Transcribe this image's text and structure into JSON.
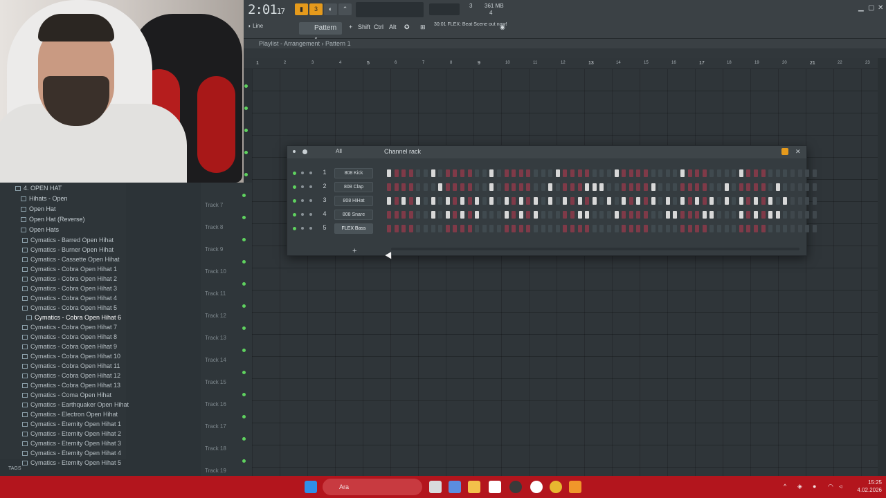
{
  "toolbar": {
    "time": "2:01",
    "time_sub": "17",
    "cpu_label": "361 MB",
    "cpu_sub": "4",
    "poly": "3",
    "snap": "Line",
    "pattern": "Pattern 1",
    "shift": "Shift",
    "ctrl": "Ctrl",
    "alt": "Alt",
    "hint_time": "30:01",
    "hint_text": "FLEX: Beat Scene out now!"
  },
  "playlist": {
    "title": "Playlist - Arrangement",
    "pattern": "Pattern 1",
    "ruler": [
      "1",
      "2",
      "3",
      "4",
      "5",
      "6",
      "7",
      "8",
      "9",
      "10",
      "11",
      "12",
      "13",
      "14",
      "15",
      "16",
      "17",
      "18",
      "19",
      "20",
      "21",
      "22",
      "23"
    ]
  },
  "browser": {
    "folder": "4. OPEN HAT",
    "subfolders": [
      "Hihats - Open",
      "Open Hat",
      "Open Hat (Reverse)",
      "Open Hats"
    ],
    "files": [
      "Cymatics - Barred Open Hihat",
      "Cymatics - Burner Open Hihat",
      "Cymatics - Cassette Open Hihat",
      "Cymatics - Cobra Open Hihat 1",
      "Cymatics - Cobra Open Hihat 2",
      "Cymatics - Cobra Open Hihat 3",
      "Cymatics - Cobra Open Hihat 4",
      "Cymatics - Cobra Open Hihat 5",
      "Cymatics - Cobra Open Hihat 6",
      "Cymatics - Cobra Open Hihat 7",
      "Cymatics - Cobra Open Hihat 8",
      "Cymatics - Cobra Open Hihat 9",
      "Cymatics - Cobra Open Hihat 10",
      "Cymatics - Cobra Open Hihat 11",
      "Cymatics - Cobra Open Hihat 12",
      "Cymatics - Cobra Open Hihat 13",
      "Cymatics - Coma Open Hihat",
      "Cymatics - Earthquaker Open Hihat",
      "Cymatics - Electron Open Hihat",
      "Cymatics - Eternity Open Hihat 1",
      "Cymatics - Eternity Open Hihat 2",
      "Cymatics - Eternity Open Hihat 3",
      "Cymatics - Eternity Open Hihat 4",
      "Cymatics - Eternity Open Hihat 5"
    ],
    "selected": "Cymatics - Cobra Open Hihat 6",
    "tags_label": "TAGS"
  },
  "tracks": [
    "Track 7",
    "Track 8",
    "Track 9",
    "Track 10",
    "Track 11",
    "Track 12",
    "Track 13",
    "Track 14",
    "Track 15",
    "Track 16",
    "Track 17",
    "Track 18",
    "Track 19"
  ],
  "rack": {
    "title": "Channel rack",
    "filter": "All",
    "add": "+",
    "channels": [
      {
        "num": "1",
        "name": "808 Kick",
        "steps": "1000001000000010000000010000000100000000100000001000000"
      },
      {
        "num": "2",
        "name": "808 Clap",
        "steps": "0000000100000010000000100001110000001000000000100000010"
      },
      {
        "num": "3",
        "name": "808 HiHat",
        "steps": "1010101010101010101010101010101010101010101010101010101"
      },
      {
        "num": "4",
        "name": "808 Snare",
        "steps": "0000001010101000101010000011000100000011000110001010110"
      },
      {
        "num": "5",
        "name": "FLEX Bass",
        "steps": "0000000000000000000000000000000000000000000000000000000"
      }
    ]
  },
  "taskbar": {
    "search": "Ara",
    "time": "15:25",
    "date": "4.02.2026"
  }
}
